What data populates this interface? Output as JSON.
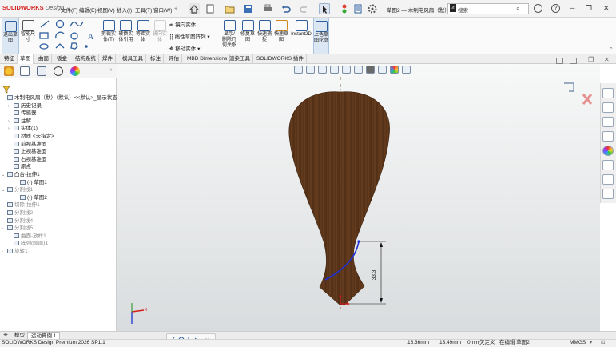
{
  "app": {
    "logo_brand": "SOLIDWORKS",
    "logo_sub": "Design",
    "doc_title": "草图2 — 木制电风扇（默）…",
    "search_placeholder": "搜索",
    "window_controls": [
      "─",
      "❐",
      "✕"
    ]
  },
  "menu": [
    "文件(F)",
    "编辑(E)",
    "视图(V)",
    "插入(I)",
    "工具(T)",
    "窗口(W)"
  ],
  "commands": [
    {
      "label": "退出草\n图"
    },
    {
      "label": "智能尺\n寸"
    },
    {
      "label": "剪裁实\n体(T)"
    },
    {
      "label": "转换实\n体引用"
    },
    {
      "label": "等距实\n体"
    },
    {
      "label": "镜向实\n体"
    },
    {
      "label": "显示/\n删除几\n何关系"
    },
    {
      "label": "修复草\n图"
    },
    {
      "label": "快速捕\n捉"
    },
    {
      "label": "快速草\n图"
    },
    {
      "label": "Instant2D"
    },
    {
      "label": "上色草\n图轮廓"
    }
  ],
  "small_commands": [
    "镜向实体",
    "线性草图阵列",
    "移动实体"
  ],
  "tabs": [
    "特征",
    "草图",
    "曲面",
    "钣金",
    "结构系统",
    "焊件",
    "模具工具",
    "标注",
    "评估",
    "MBD Dimensions",
    "渲染工具",
    "SOLIDWORKS 插件"
  ],
  "active_tab_index": 1,
  "tree": [
    {
      "arrow": "",
      "label": "木制电风扇（默）（默认）<<默认>_显示状态 1>",
      "grey": false,
      "indent": 0
    },
    {
      "arrow": "›",
      "label": "历史记录",
      "grey": false,
      "indent": 1
    },
    {
      "arrow": "",
      "label": "传感器",
      "grey": false,
      "indent": 1
    },
    {
      "arrow": "›",
      "label": "注解",
      "grey": false,
      "indent": 1
    },
    {
      "arrow": "›",
      "label": "实体(1)",
      "grey": false,
      "indent": 1
    },
    {
      "arrow": "",
      "label": "材质 <未指定>",
      "grey": false,
      "indent": 1
    },
    {
      "arrow": "",
      "label": "前视基准面",
      "grey": false,
      "indent": 1
    },
    {
      "arrow": "",
      "label": "上视基准面",
      "grey": false,
      "indent": 1
    },
    {
      "arrow": "",
      "label": "右视基准面",
      "grey": false,
      "indent": 1
    },
    {
      "arrow": "",
      "label": "原点",
      "grey": false,
      "indent": 1
    },
    {
      "arrow": "⌄",
      "label": "凸台-拉伸1",
      "grey": false,
      "indent": 0
    },
    {
      "arrow": "",
      "label": "(-) 草图1",
      "grey": false,
      "indent": 2
    },
    {
      "arrow": "⌄",
      "label": "分割线1",
      "grey": true,
      "indent": 0
    },
    {
      "arrow": "",
      "label": "(-) 草图2",
      "grey": false,
      "indent": 2
    },
    {
      "arrow": "›",
      "label": "切除-拉伸1",
      "grey": true,
      "indent": 0
    },
    {
      "arrow": "›",
      "label": "分割线2",
      "grey": true,
      "indent": 0
    },
    {
      "arrow": "›",
      "label": "分割线4",
      "grey": true,
      "indent": 0
    },
    {
      "arrow": "›",
      "label": "分割线5",
      "grey": true,
      "indent": 0
    },
    {
      "arrow": "",
      "label": "曲面-放样1",
      "grey": true,
      "indent": 1
    },
    {
      "arrow": "",
      "label": "阵列(圆周)1",
      "grey": true,
      "indent": 1
    },
    {
      "arrow": "›",
      "label": "旋转1",
      "grey": true,
      "indent": 0
    }
  ],
  "dimension_label": "33.3",
  "model_tabs": [
    "模型",
    "运动算例 1"
  ],
  "status": {
    "product": "SOLIDWORKS Design Premium 2026 SP1.1",
    "x": "16.36mm",
    "y": "13.49mm",
    "z": "0mm",
    "state": "欠定义",
    "editing": "在编辑 草图2",
    "units": "MMGS"
  },
  "colors": {
    "accent": "#2f6fb3",
    "wood": "#5a3418",
    "sketch_blue": "#1f2fd0",
    "dim_black": "#111111",
    "origin_red": "#d41c1c"
  }
}
